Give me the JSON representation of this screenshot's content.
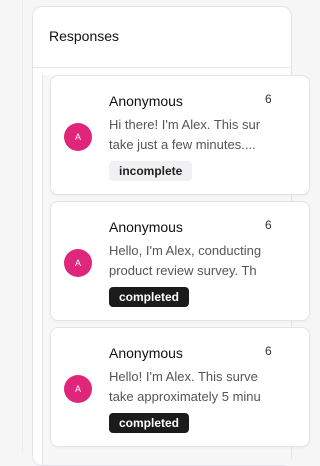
{
  "panel": {
    "title": "Responses"
  },
  "responses": [
    {
      "avatar": "A",
      "author": "Anonymous",
      "time": "6",
      "line1": "Hi there! I'm Alex. This sur",
      "line2": "take just a few minutes....",
      "status": "incomplete"
    },
    {
      "avatar": "A",
      "author": "Anonymous",
      "time": "6",
      "line1": "Hello, I'm Alex, conducting",
      "line2": "product review survey. Th",
      "status": "completed"
    },
    {
      "avatar": "A",
      "author": "Anonymous",
      "time": "6",
      "line1": "Hello! I'm Alex. This surve",
      "line2": "take approximately 5 minu",
      "status": "completed"
    }
  ],
  "colors": {
    "avatar": "#e0267a",
    "badge_completed": "#1b1b1b",
    "badge_incomplete": "#f1f1f3"
  }
}
